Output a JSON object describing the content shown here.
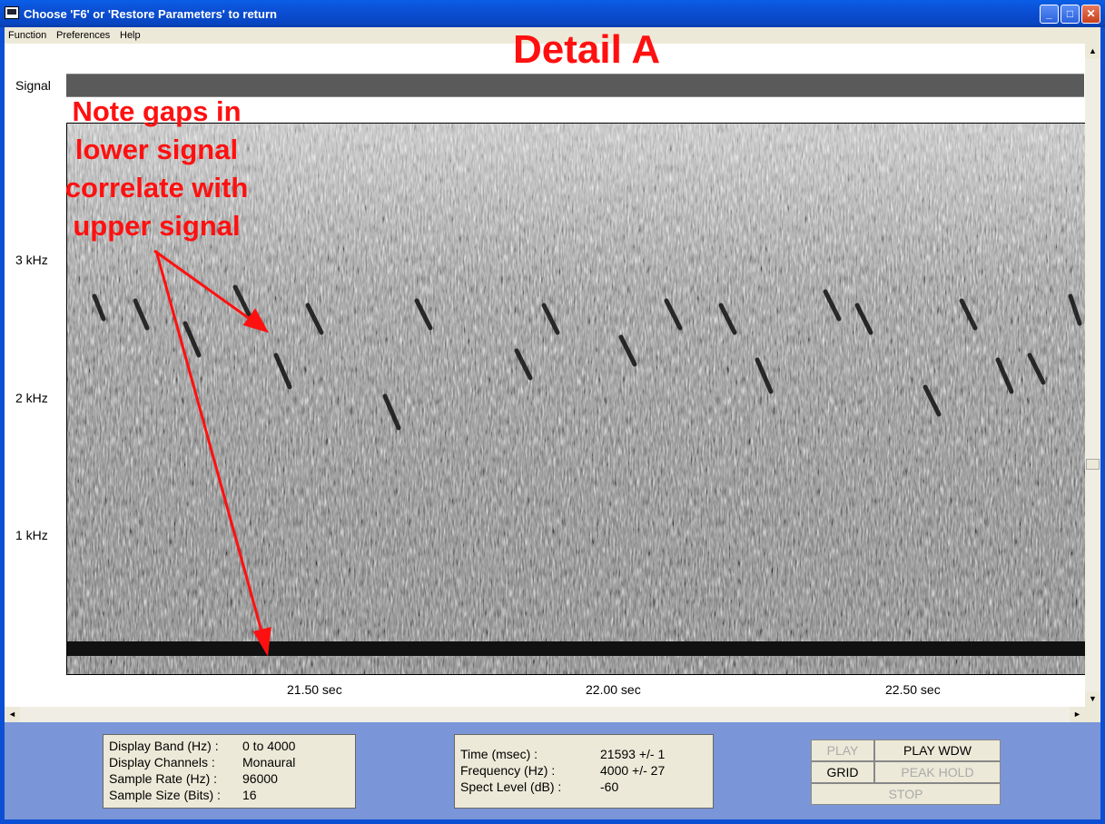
{
  "window": {
    "title": "Choose 'F6' or 'Restore Parameters' to return"
  },
  "menu": [
    "Function",
    "Preferences",
    "Help"
  ],
  "window_controls": {
    "minimize": "_",
    "maximize": "□",
    "close": "✕"
  },
  "annotation": {
    "heading": "Detail A",
    "note_lines": [
      "Note gaps in",
      "lower signal",
      "correlate with",
      "upper signal"
    ],
    "color": "#ff1010"
  },
  "axis": {
    "signal_label": "Signal",
    "freq_labels": [
      "3 kHz",
      "2 kHz",
      "1 kHz"
    ],
    "time_labels": [
      "21.50 sec",
      "22.00 sec",
      "22.50 sec"
    ]
  },
  "info_left": {
    "rows": [
      {
        "label": "Display Band (Hz) :",
        "value": "0 to 4000"
      },
      {
        "label": "Display Channels :",
        "value": "Monaural"
      },
      {
        "label": "Sample Rate (Hz) :",
        "value": "96000"
      },
      {
        "label": "Sample Size (Bits) :",
        "value": "16"
      }
    ]
  },
  "info_right": {
    "rows": [
      {
        "label": "Time (msec) :",
        "value": "21593 +/- 1"
      },
      {
        "label": "Frequency (Hz) :",
        "value": "4000 +/- 27"
      },
      {
        "label": "Spect Level (dB) :",
        "value": "-60"
      }
    ]
  },
  "buttons": {
    "play": "PLAY",
    "play_wdw": "PLAY WDW",
    "grid": "GRID",
    "peak_hold": "PEAK HOLD",
    "stop": "STOP"
  },
  "scrollbar_arrows": {
    "up": "▲",
    "down": "▼",
    "left": "◄",
    "right": "►"
  },
  "colors": {
    "title_bar": "#0b4fd4",
    "panel": "#7b96d8",
    "annotation": "#ff1010"
  }
}
